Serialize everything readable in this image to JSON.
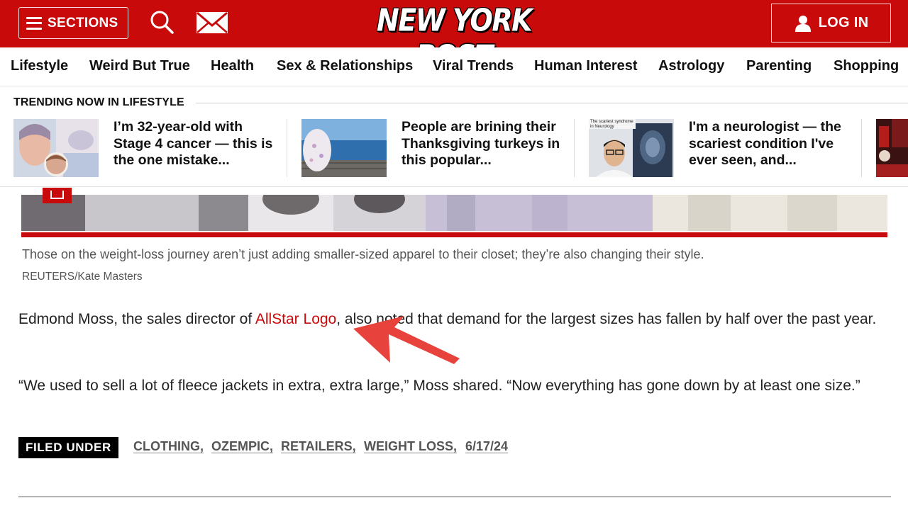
{
  "header": {
    "sections_label": "SECTIONS",
    "logo_text": "NEW YORK POST",
    "login_label": "LOG IN",
    "brand_color": "#c80a0a",
    "icons": [
      "hamburger-icon",
      "search-icon",
      "mail-icon",
      "user-icon"
    ]
  },
  "category_nav": {
    "items": [
      "Lifestyle",
      "Weird But True",
      "Health",
      "Sex & Relationships",
      "Viral Trends",
      "Human Interest",
      "Astrology",
      "Parenting",
      "Shopping"
    ]
  },
  "trending": {
    "heading": "TRENDING NOW IN LIFESTYLE",
    "items": [
      {
        "title": "I’m 32-year-old with Stage 4 cancer — this is the one mistake..."
      },
      {
        "title": "People are brining their Thanksgiving turkeys in this popular..."
      },
      {
        "title": "I'm a neurologist — the scariest condition I've ever seen, and...",
        "thumb_caption": "The scariest syndrome in Neurology"
      }
    ]
  },
  "article": {
    "caption": "Those on the weight-loss journey aren’t just adding smaller-sized apparel to their closet; they’re also changing their style.",
    "credit": "REUTERS/Kate Masters",
    "para1_before": "Edmond Moss, the sales director of ",
    "para1_link": "AllStar Logo",
    "para1_after": ", also noted that demand for the largest sizes has fallen by half over the past year.",
    "para2": "“We used to sell a lot of fleece jackets in extra, extra large,” Moss shared. “Now everything has gone down by at least one size.”"
  },
  "filed_under": {
    "label": "FILED UNDER",
    "tags": [
      "CLOTHING,",
      "OZEMPIC,",
      "RETAILERS,",
      "WEIGHT LOSS,",
      "6/17/24"
    ]
  },
  "annotation": {
    "arrow_color": "#e8423c"
  }
}
